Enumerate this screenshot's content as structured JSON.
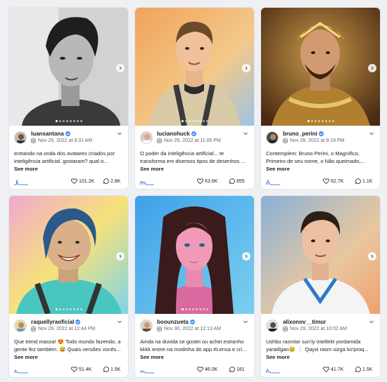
{
  "posts": [
    {
      "username": "luansantana",
      "date": "Nov 29, 2022 at 9:31 AM",
      "caption": "entrando na onda dos avatares criados por inteligência artificial. gostaram? qual o...",
      "see_more": "See more",
      "likes": "101.2K",
      "comments": "2.8K",
      "image": "portrait-bw"
    },
    {
      "username": "lucianohuck",
      "date": "Nov 29, 2022 at 11:05 PM",
      "caption": "O poder da inteligência artificial... te transforma em diversos tipos de desenhos ...",
      "see_more": "See more",
      "likes": "63.6K",
      "comments": "855",
      "image": "portrait-jacket"
    },
    {
      "username": "bruno_perini",
      "date": "Nov 28, 2022 at 9:19 PM",
      "caption": "Contemplem: Bruno Perini, o Magnífico, Primeiro de seu nome, o Não queimado,...",
      "see_more": "See more",
      "likes": "62.7K",
      "comments": "1.1K",
      "image": "portrait-gold"
    },
    {
      "username": "raquellyraoficial",
      "date": "Nov 29, 2022 at 12:44 PM",
      "caption": "Que trend massa! 😍 Todo mundo fazendo, a gente fez também. 😅 Quais versões vocês...",
      "see_more": "See more",
      "likes": "51.4K",
      "comments": "1.5K",
      "image": "portrait-colorful"
    },
    {
      "username": "boounzueta",
      "date": "Nov 30, 2022 at 12:13 AM",
      "caption": "Ainda na duvida se gostei ou achei estranho kkkk entrei na modinha do app #Lensa e cri...",
      "see_more": "See more",
      "likes": "46.0K",
      "comments": "181",
      "image": "portrait-neon"
    },
    {
      "username": "alixonov__timur",
      "date": "Nov 29, 2022 at 10:02 AM",
      "caption": "Ushbu rasmlar sun'iy intellekt yordamida yaratilgan😢 ❕ Qaysi rasm sizga ko'proq...",
      "see_more": "See more",
      "likes": "41.7K",
      "comments": "1.5K",
      "image": "portrait-suit"
    }
  ],
  "colors": {
    "verified": "#3a8af7",
    "chart_line": "#4a8ad8"
  }
}
